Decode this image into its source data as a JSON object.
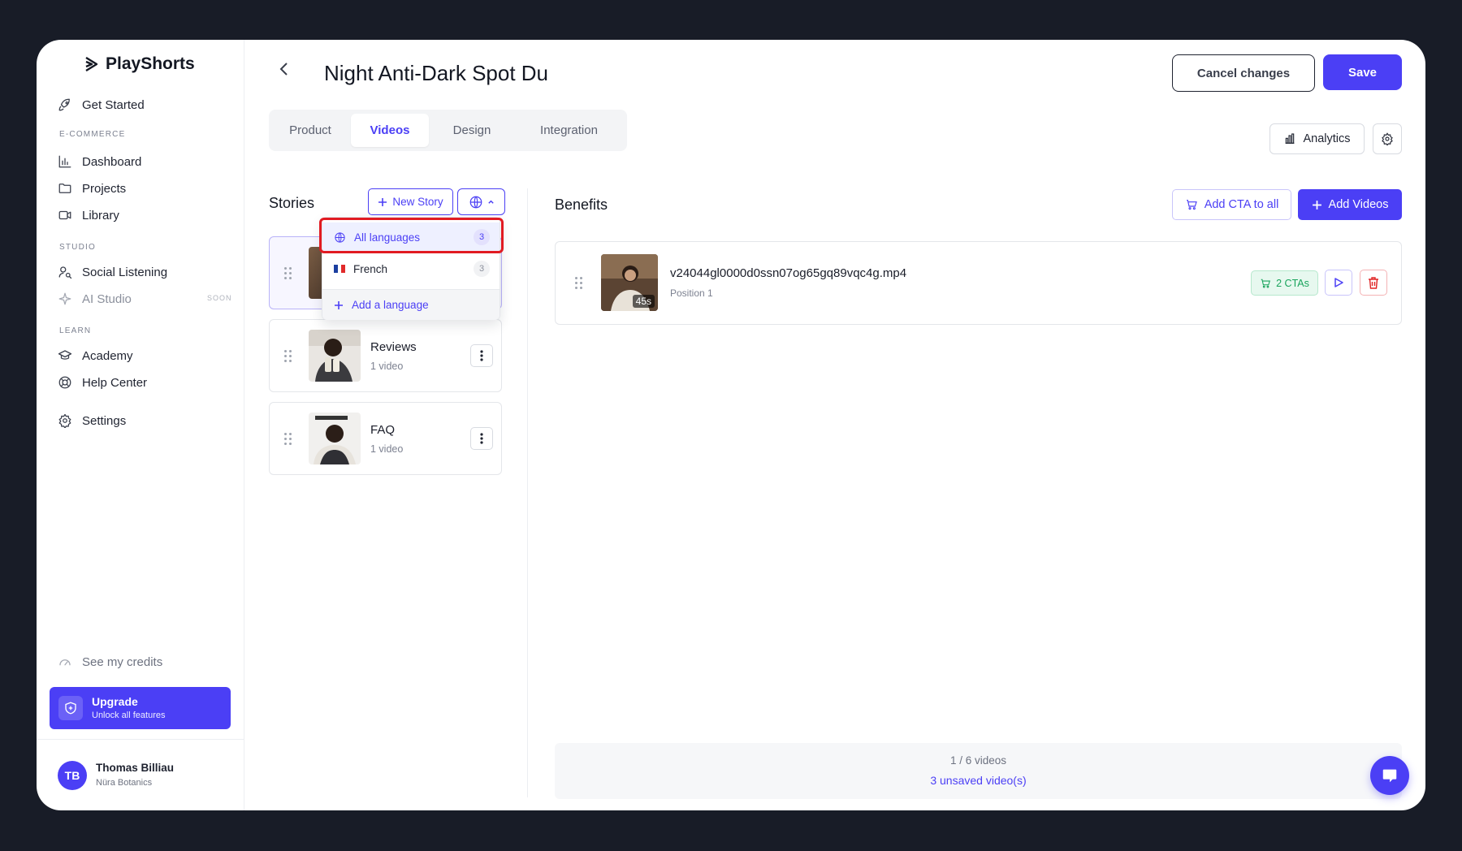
{
  "brand": {
    "name": "PlayShorts"
  },
  "sidebar": {
    "get_started": "Get Started",
    "sections": {
      "ecommerce": "E-COMMERCE",
      "studio": "STUDIO",
      "learn": "LEARN"
    },
    "items": {
      "dashboard": "Dashboard",
      "projects": "Projects",
      "library": "Library",
      "social_listening": "Social Listening",
      "ai_studio": "AI Studio",
      "ai_studio_badge": "SOON",
      "academy": "Academy",
      "help_center": "Help Center",
      "settings": "Settings"
    },
    "credits": "See my credits",
    "upgrade": {
      "title": "Upgrade",
      "subtitle": "Unlock all features"
    },
    "user": {
      "initials": "TB",
      "name": "Thomas Billiau",
      "org": "Nüra Botanics"
    }
  },
  "header": {
    "title": "Night Anti-Dark Spot Du",
    "cancel_label": "Cancel changes",
    "save_label": "Save",
    "analytics_label": "Analytics"
  },
  "tabs": [
    {
      "label": "Product",
      "active": false
    },
    {
      "label": "Videos",
      "active": true
    },
    {
      "label": "Design",
      "active": false
    },
    {
      "label": "Integration",
      "active": false
    }
  ],
  "stories": {
    "title": "Stories",
    "new_story_label": "New Story",
    "items": [
      {
        "name": "",
        "sub": ""
      },
      {
        "name": "Reviews",
        "sub": "1 video"
      },
      {
        "name": "FAQ",
        "sub": "1 video"
      }
    ]
  },
  "language_dropdown": {
    "options": [
      {
        "label": "All languages",
        "count": "3",
        "active": true
      },
      {
        "label": "French",
        "count": "3",
        "active": false
      }
    ],
    "add_label": "Add a language"
  },
  "benefits": {
    "title": "Benefits",
    "add_cta_label": "Add CTA to all",
    "add_videos_label": "Add Videos",
    "videos": [
      {
        "filename": "v24044gl0000d0ssn07og65gq89vqc4g.mp4",
        "position": "Position 1",
        "duration": "45s",
        "cta_badge": "2 CTAs"
      }
    ],
    "footer": {
      "count": "1 / 6 videos",
      "unsaved": "3 unsaved video(s)"
    }
  },
  "colors": {
    "accent": "#4b3ff5",
    "highlight": "#e11b22",
    "success": "#19a45c",
    "danger": "#e02424"
  }
}
